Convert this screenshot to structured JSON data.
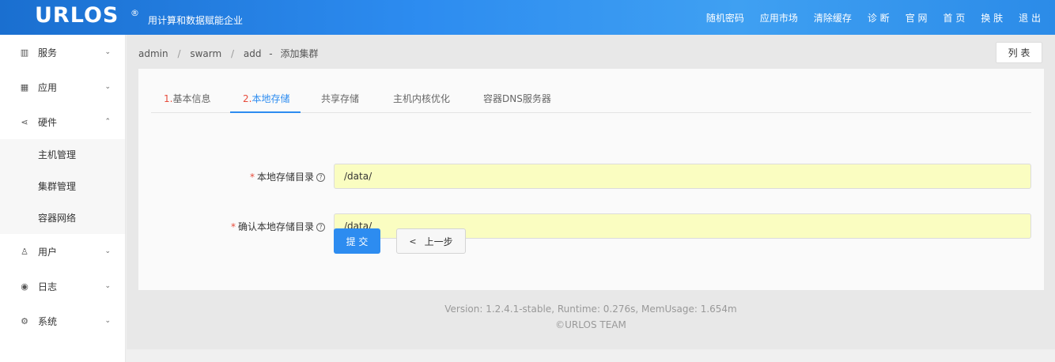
{
  "header": {
    "logo": "URLOS",
    "logo_mark": "®",
    "slogan": "用计算和数据赋能企业",
    "nav": [
      "随机密码",
      "应用市场",
      "清除缓存",
      "诊 断",
      "官 网",
      "首 页",
      "换 肤",
      "退 出"
    ]
  },
  "sidebar": {
    "items": [
      {
        "label": "服务",
        "icon": "app-grid-icon",
        "glyph": "▥",
        "chevron": "⌄"
      },
      {
        "label": "应用",
        "icon": "grid-icon",
        "glyph": "▦",
        "chevron": "⌄"
      },
      {
        "label": "硬件",
        "icon": "share-icon",
        "glyph": "⋖",
        "chevron": "⌃"
      },
      {
        "label": "用户",
        "icon": "user-icon",
        "glyph": "♙",
        "chevron": "⌄"
      },
      {
        "label": "日志",
        "icon": "eye-icon",
        "glyph": "◉",
        "chevron": "⌄"
      },
      {
        "label": "系统",
        "icon": "gear-icon",
        "glyph": "⚙",
        "chevron": "⌄"
      }
    ],
    "sub_items": [
      "主机管理",
      "集群管理",
      "容器网络"
    ]
  },
  "breadcrumb": {
    "parts": [
      "admin",
      "swarm",
      "add"
    ],
    "separator": "/",
    "dash": "-",
    "title": "添加集群"
  },
  "list_button": "列 表",
  "tabs": [
    {
      "num": "1.",
      "label": "基本信息"
    },
    {
      "num": "2.",
      "label": "本地存储"
    },
    {
      "num": "",
      "label": "共享存储"
    },
    {
      "num": "",
      "label": "主机内核优化"
    },
    {
      "num": "",
      "label": "容器DNS服务器"
    }
  ],
  "form": {
    "required_mark": "*",
    "help_glyph": "?",
    "local_dir": {
      "label": "本地存储目录",
      "value": "/data/"
    },
    "confirm_dir": {
      "label": "确认本地存储目录",
      "value": "/data/"
    }
  },
  "buttons": {
    "submit": "提 交",
    "prev_arrow": "<",
    "prev": "上一步"
  },
  "footer": {
    "version": "Version: 1.2.4.1-stable,   Runtime: 0.276s,   MemUsage: 1.654m",
    "copyright": "©URLOS TEAM"
  },
  "colors": {
    "accent": "#2d8cf0",
    "required": "#e74c3c",
    "input_bg": "#fafdc1"
  }
}
